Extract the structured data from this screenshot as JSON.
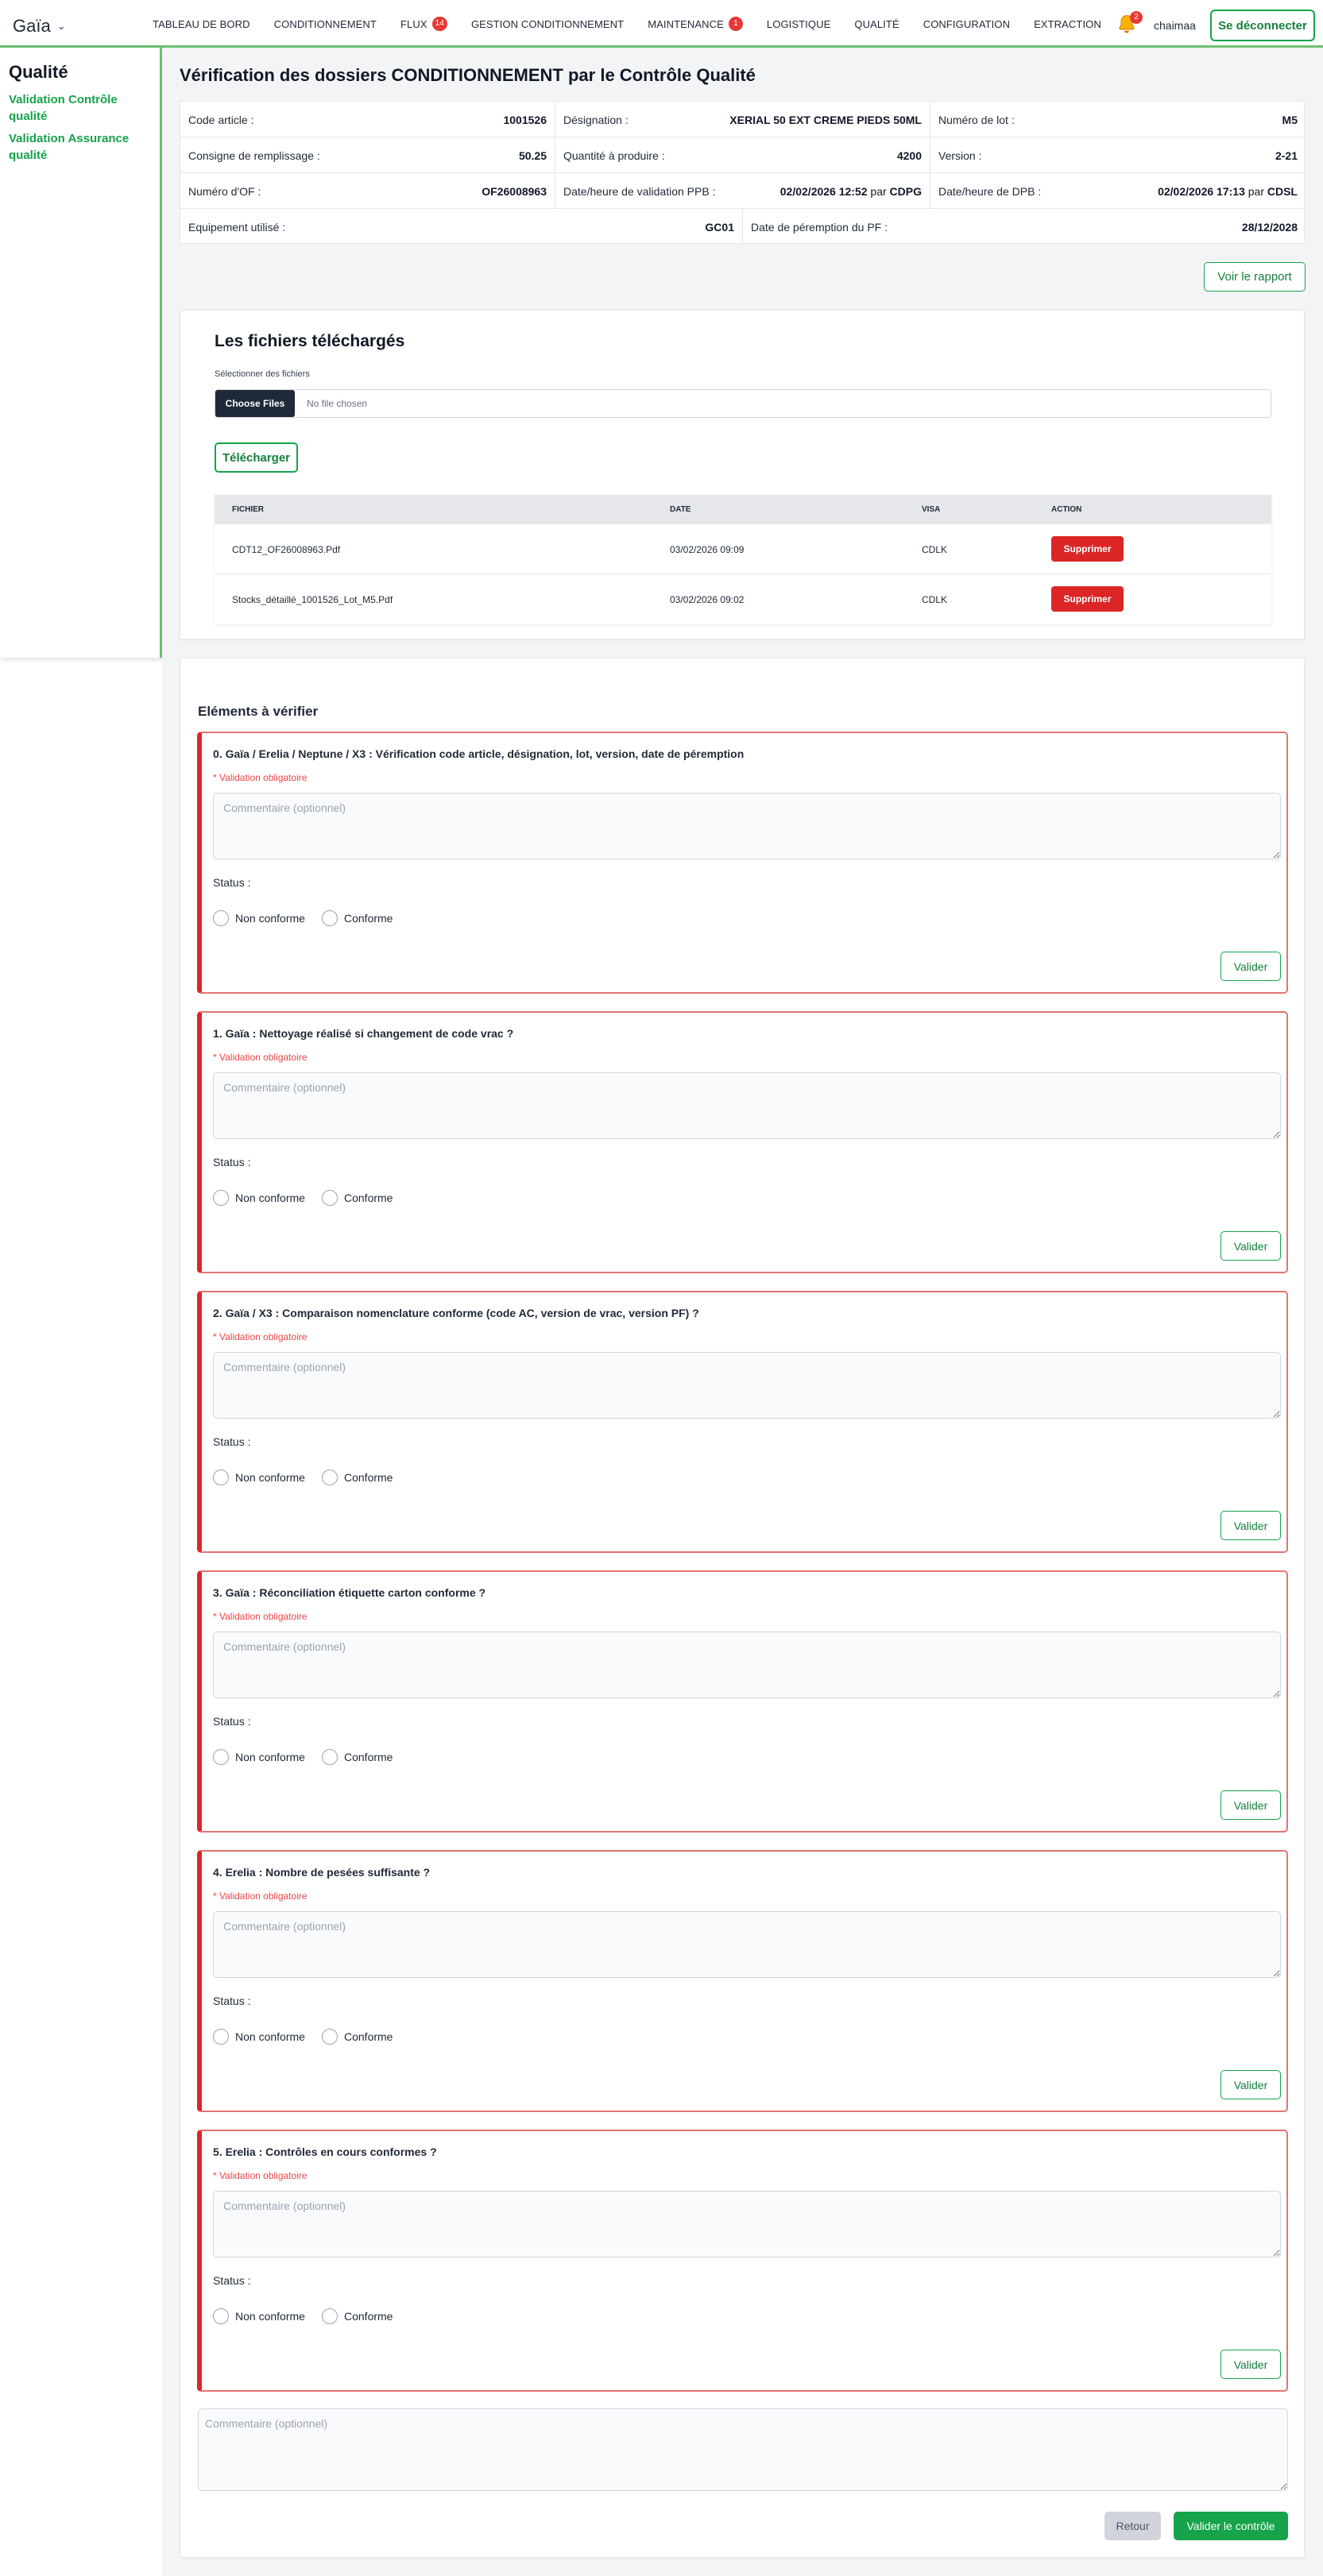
{
  "nav": {
    "brand": "Gaïa",
    "links": [
      {
        "label": "TABLEAU DE BORD",
        "badge": ""
      },
      {
        "label": "CONDITIONNEMENT",
        "badge": ""
      },
      {
        "label": "FLUX",
        "badge": "14"
      },
      {
        "label": "GESTION CONDITIONNEMENT",
        "badge": ""
      },
      {
        "label": "MAINTENANCE",
        "badge": "1"
      },
      {
        "label": "LOGISTIQUE",
        "badge": ""
      },
      {
        "label": "QUALITÉ",
        "badge": ""
      },
      {
        "label": "CONFIGURATION",
        "badge": ""
      },
      {
        "label": "EXTRACTION",
        "badge": ""
      }
    ],
    "notifications_count": "2",
    "username": "chaimaa",
    "logout_label": "Se déconnecter"
  },
  "sidebar": {
    "title": "Qualité",
    "items": [
      {
        "label": "Validation Contrôle qualité"
      },
      {
        "label": "Validation Assurance qualité"
      }
    ]
  },
  "page": {
    "title": "Vérification des dossiers CONDITIONNEMENT par le Contrôle Qualité",
    "info": {
      "code_article": {
        "label": "Code article :",
        "value": "1001526"
      },
      "designation": {
        "label": "Désignation :",
        "value": "XERIAL 50 EXT CREME PIEDS 50ML"
      },
      "lot": {
        "label": "Numéro de lot :",
        "value": "M5"
      },
      "consigne": {
        "label": "Consigne de remplissage :",
        "value": "50.25"
      },
      "quantite": {
        "label": "Quantité à produire :",
        "value": "4200"
      },
      "version": {
        "label": "Version :",
        "value": "2-21"
      },
      "of": {
        "label": "Numéro d'OF :",
        "value": "OF26008963"
      },
      "validation_ppb": {
        "label": "Date/heure de validation PPB :",
        "datetime": "02/02/2026 12:52",
        "par": "par",
        "who": "CDPG"
      },
      "dpb": {
        "label": "Date/heure de DPB :",
        "datetime": "02/02/2026 17:13",
        "par": "par",
        "who": "CDSL"
      },
      "equipement": {
        "label": "Equipement utilisé :",
        "value": "GC01"
      },
      "peremption": {
        "label": "Date de péremption du PF :",
        "value": "28/12/2028"
      }
    },
    "report_button": "Voir le rapport"
  },
  "files": {
    "title": "Les fichiers téléchargés",
    "select_label": "Sélectionner des fichiers",
    "choose_button": "Choose Files",
    "no_file": "No file chosen",
    "upload_button": "Télécharger",
    "columns": [
      "FICHIER",
      "DATE",
      "VISA",
      "ACTION"
    ],
    "rows": [
      {
        "file": "CDT12_OF26008963.Pdf",
        "date": "03/02/2026 09:09",
        "visa": "CDLK",
        "action": "Supprimer"
      },
      {
        "file": "Stocks_détaillé_1001526_Lot_M5.Pdf",
        "date": "03/02/2026 09:02",
        "visa": "CDLK",
        "action": "Supprimer"
      }
    ]
  },
  "checks": {
    "title": "Eléments à vérifier",
    "required_text": "* Validation obligatoire",
    "comment_placeholder": "Commentaire (optionnel)",
    "status_label": "Status :",
    "option_non_conforme": "Non conforme",
    "option_conforme": "Conforme",
    "validate_button": "Valider",
    "items": [
      {
        "label": "0. Gaïa / Erelia / Neptune / X3 : Vérification code article, désignation, lot, version, date de péremption"
      },
      {
        "label": "1. Gaïa : Nettoyage réalisé si changement de code vrac ?"
      },
      {
        "label": "2. Gaïa / X3 : Comparaison nomenclature conforme (code AC, version de vrac, version PF) ?"
      },
      {
        "label": "3. Gaïa : Réconciliation étiquette carton conforme ?"
      },
      {
        "label": "4. Erelia : Nombre de pesées suffisante ?"
      },
      {
        "label": "5. Erelia : Contrôles en cours conformes ?"
      }
    ],
    "final_comment_placeholder": "Commentaire (optionnel)",
    "back_button": "Retour",
    "submit_button": "Valider le contrôle"
  },
  "colors": {
    "accent_green": "#16a34a",
    "danger_red": "#dc2626",
    "nav_underline": "#6fbf73"
  }
}
